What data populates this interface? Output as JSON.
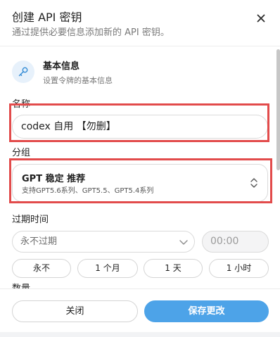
{
  "dialog": {
    "title": "创建 API 密钥",
    "subtitle": "通过提供必要信息添加新的 API 密钥。",
    "close_icon": "close-icon"
  },
  "section": {
    "icon": "key-icon",
    "title": "基本信息",
    "description": "设置令牌的基本信息"
  },
  "name_field": {
    "label": "名称",
    "value": "codex 自用 【勿删】"
  },
  "group_field": {
    "label": "分组",
    "selected_title": "GPT 稳定 推荐",
    "selected_subtitle": "支持GPT5.6系列、GPT5.5、GPT5.4系列",
    "icon": "chevron-up-down-icon"
  },
  "expiry": {
    "label": "过期时间",
    "dropdown_value": "永不过期",
    "dropdown_icon": "chevron-down-icon",
    "time_value": "00:00",
    "chips": [
      "永不",
      "1 个月",
      "1 天",
      "1 小时"
    ]
  },
  "next_label_partial": "数量",
  "footer": {
    "cancel_label": "关闭",
    "save_label": "保存更改"
  },
  "colors": {
    "accent": "#4da3e8",
    "highlight": "#e24b4b",
    "icon_bg": "#e7f1fb"
  }
}
